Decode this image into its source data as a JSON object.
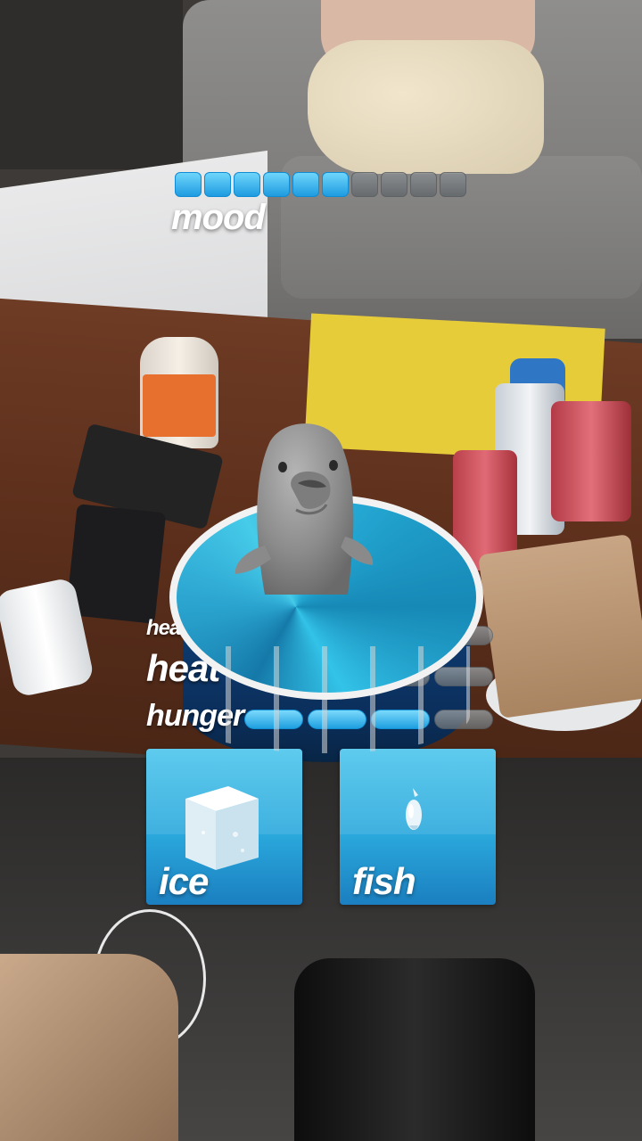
{
  "mood": {
    "label": "mood",
    "level": 6,
    "max": 10
  },
  "stats": [
    {
      "label": "head pats",
      "level": 0,
      "max": 4
    },
    {
      "label": "heat",
      "level": 2,
      "max": 4
    },
    {
      "label": "hunger",
      "level": 3,
      "max": 4
    }
  ],
  "actions": {
    "ice_label": "ice",
    "fish_label": "fish"
  },
  "colors": {
    "bar_on": "#1e9be0",
    "bar_off": "#62676b",
    "card": "#2aa8dc",
    "pool_water": "#25a9d4",
    "pool_wall": "#0b2f5c"
  },
  "icons": {
    "ice": "ice-cube-icon",
    "fish": "fish-icon"
  }
}
